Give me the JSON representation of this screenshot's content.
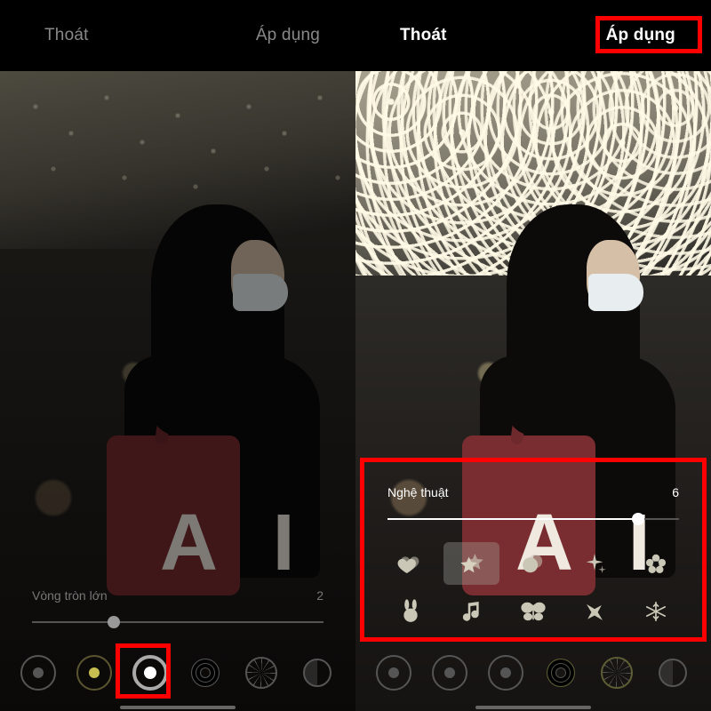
{
  "left": {
    "exit_label": "Thoát",
    "apply_label": "Áp dụng",
    "slider_label": "Vòng tròn lớn",
    "slider_value": "2",
    "slider_percent": 28,
    "photo_text": "A I",
    "selected_lens_index": 2
  },
  "right": {
    "exit_label": "Thoát",
    "apply_label": "Áp dụng",
    "slider_label": "Nghệ thuật",
    "slider_value": "6",
    "slider_percent": 86,
    "photo_text": "A I",
    "selected_shape_index": 1,
    "shapes": [
      "heart",
      "star",
      "circle",
      "sparkle",
      "flower",
      "bunny",
      "music-note",
      "butterfly",
      "airplane",
      "snowflake"
    ],
    "selected_lens_index": 4
  },
  "lens_icons": [
    "solid-dot",
    "yellow-dot",
    "white-dot",
    "concentric",
    "spokes",
    "half"
  ],
  "highlight_color": "#ff0000"
}
